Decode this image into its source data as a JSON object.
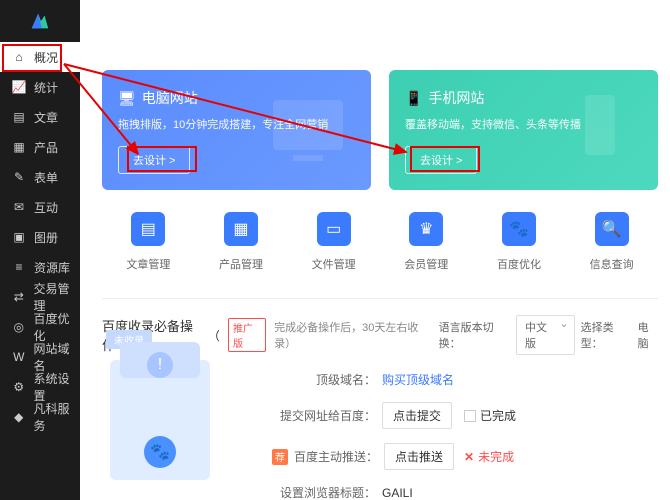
{
  "sidebar": {
    "items": [
      {
        "label": "概况",
        "icon": "home"
      },
      {
        "label": "统计",
        "icon": "chart"
      },
      {
        "label": "文章",
        "icon": "doc"
      },
      {
        "label": "产品",
        "icon": "grid"
      },
      {
        "label": "表单",
        "icon": "form"
      },
      {
        "label": "互动",
        "icon": "chat"
      },
      {
        "label": "图册",
        "icon": "image"
      },
      {
        "label": "资源库",
        "icon": "db"
      },
      {
        "label": "交易管理",
        "icon": "trade"
      },
      {
        "label": "百度优化",
        "icon": "seo"
      },
      {
        "label": "网站域名",
        "icon": "domain"
      },
      {
        "label": "系统设置",
        "icon": "gear"
      },
      {
        "label": "凡科服务",
        "icon": "service"
      }
    ]
  },
  "cards": {
    "pc": {
      "title": "电脑网站",
      "desc": "拖拽排版，10分钟完成搭建，专注全网营销",
      "btn": "去设计 >"
    },
    "mobile": {
      "title": "手机网站",
      "desc": "覆盖移动端，支持微信、头条等传播",
      "btn": "去设计 >"
    }
  },
  "quick": [
    {
      "label": "文章管理"
    },
    {
      "label": "产品管理"
    },
    {
      "label": "文件管理"
    },
    {
      "label": "会员管理"
    },
    {
      "label": "百度优化"
    },
    {
      "label": "信息查询"
    }
  ],
  "baidu": {
    "title": "百度收录必备操作",
    "promo_tag": "推广版",
    "note": "完成必备操作后，30天左右收录）",
    "lang_label": "语言版本切换：",
    "lang_value": "中文版",
    "type_label": "选择类型：",
    "type_value": "电脑",
    "rows": {
      "domain_label": "顶级域名：",
      "domain_action": "购买顶级域名",
      "submit_label": "提交网址给百度：",
      "submit_btn": "点击提交",
      "submit_done": "已完成",
      "push_label": "百度主动推送：",
      "push_btn": "点击推送",
      "push_status": "未完成",
      "browser_label": "设置浏览器标题：",
      "browser_value": "GAILI"
    },
    "tag_unrecorded": "未收录"
  }
}
